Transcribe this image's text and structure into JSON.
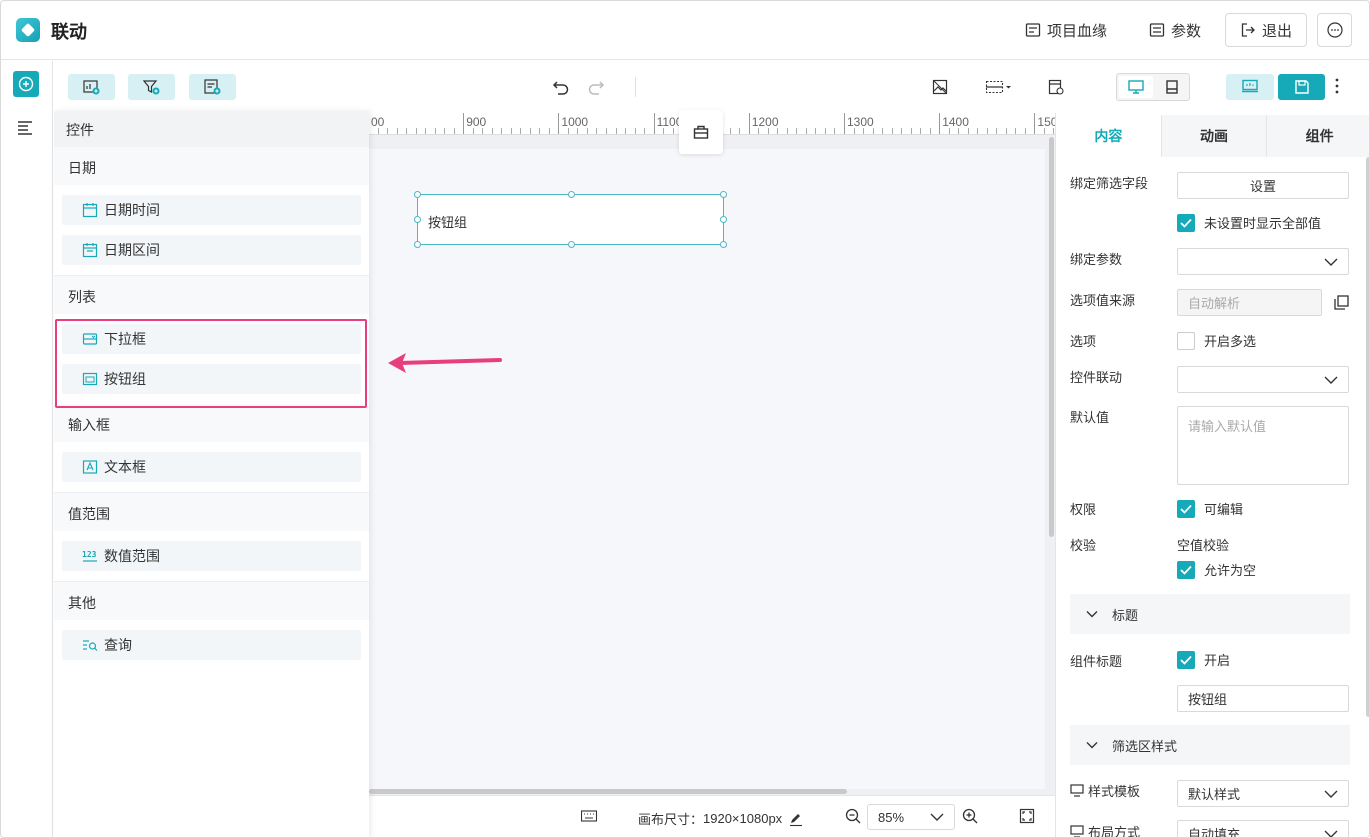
{
  "header": {
    "title": "联动",
    "lineage_label": "项目血缘",
    "params_label": "参数",
    "exit_label": "退出"
  },
  "panel": {
    "title": "控件",
    "groups": [
      {
        "title": "日期",
        "items": [
          "日期时间",
          "日期区间"
        ]
      },
      {
        "title": "列表",
        "items": [
          "下拉框",
          "按钮组"
        ]
      },
      {
        "title": "输入框",
        "items": [
          "文本框"
        ]
      },
      {
        "title": "值范围",
        "items": [
          "数值范围"
        ]
      },
      {
        "title": "其他",
        "items": [
          "查询"
        ]
      }
    ]
  },
  "ruler": {
    "labels": [
      "00",
      "900",
      "1000",
      "1100",
      "1200",
      "1300",
      "1400",
      "150"
    ]
  },
  "canvas": {
    "widget_label": "按钮组",
    "size_label": "画布尺寸：",
    "size_value": "1920×1080px",
    "zoom": "85%"
  },
  "right": {
    "tabs": [
      "内容",
      "动画",
      "组件"
    ],
    "bind_field_label": "绑定筛选字段",
    "bind_field_button": "设置",
    "show_all_label": "未设置时显示全部值",
    "bind_param_label": "绑定参数",
    "option_source_label": "选项值来源",
    "option_source_value": "自动解析",
    "options_label": "选项",
    "multi_select_label": "开启多选",
    "linkage_label": "控件联动",
    "default_label": "默认值",
    "default_placeholder": "请输入默认值",
    "permission_label": "权限",
    "editable_label": "可编辑",
    "validate_label": "校验",
    "empty_check_label": "空值校验",
    "allow_empty_label": "允许为空",
    "title_section": "标题",
    "component_title_label": "组件标题",
    "enable_label": "开启",
    "component_title_value": "按钮组",
    "filter_style_section": "筛选区样式",
    "style_template_label": "样式模板",
    "style_template_value": "默认样式",
    "layout_label": "布局方式",
    "layout_value": "自动填充"
  }
}
